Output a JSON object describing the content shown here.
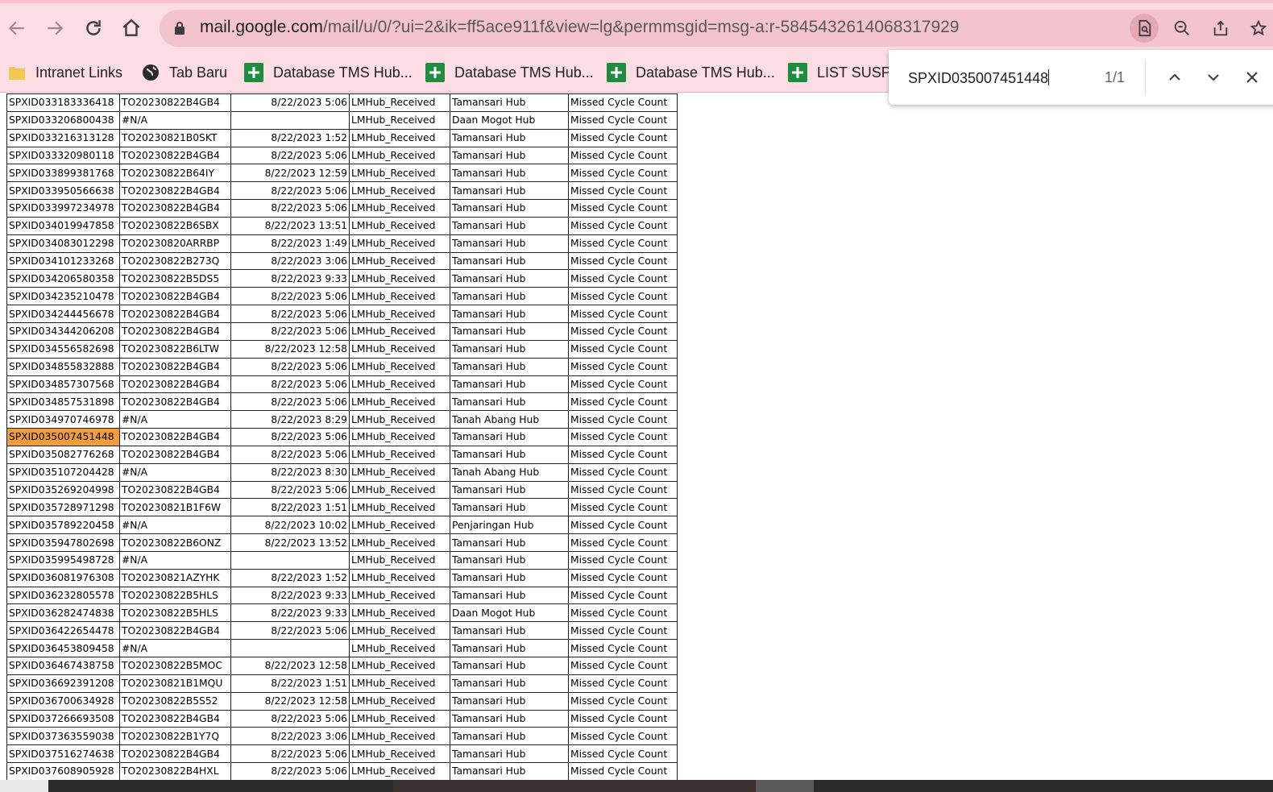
{
  "browser": {
    "url_host": "mail.google.com",
    "url_path": "/mail/u/0/?ui=2&ik=ff5ace911f&view=lg&permmsgid=msg-a:r-5845432614068317929",
    "bookmarks": [
      {
        "label": "Intranet Links",
        "icon": "folder-icon"
      },
      {
        "label": "Tab Baru",
        "icon": "globe-icon"
      },
      {
        "label": "Database TMS Hub...",
        "icon": "sheets-icon"
      },
      {
        "label": "Database TMS Hub...",
        "icon": "sheets-icon"
      },
      {
        "label": "Database TMS Hub...",
        "icon": "sheets-icon"
      },
      {
        "label": "LIST SUSPE",
        "icon": "sheets-icon"
      }
    ]
  },
  "find": {
    "query": "SPXID035007451448",
    "count": "1/1"
  },
  "colors": {
    "toolbar": "#fcdde3",
    "highlight": "#f29d3c"
  },
  "sheet": {
    "highlight_row": 19,
    "rows": [
      [
        "SPXID033183336418",
        "TO20230822B4GB4",
        "8/22/2023 5:06",
        "LMHub_Received",
        "Tamansari Hub",
        "Missed Cycle Count"
      ],
      [
        "SPXID033206800438",
        "#N/A",
        "",
        "LMHub_Received",
        "Daan Mogot Hub",
        "Missed Cycle Count"
      ],
      [
        "SPXID033216313128",
        "TO20230821B0SKT",
        "8/22/2023 1:52",
        "LMHub_Received",
        "Tamansari Hub",
        "Missed Cycle Count"
      ],
      [
        "SPXID033320980118",
        "TO20230822B4GB4",
        "8/22/2023 5:06",
        "LMHub_Received",
        "Tamansari Hub",
        "Missed Cycle Count"
      ],
      [
        "SPXID033899381768",
        "TO20230822B64IY",
        "8/22/2023 12:59",
        "LMHub_Received",
        "Tamansari Hub",
        "Missed Cycle Count"
      ],
      [
        "SPXID033950566638",
        "TO20230822B4GB4",
        "8/22/2023 5:06",
        "LMHub_Received",
        "Tamansari Hub",
        "Missed Cycle Count"
      ],
      [
        "SPXID033997234978",
        "TO20230822B4GB4",
        "8/22/2023 5:06",
        "LMHub_Received",
        "Tamansari Hub",
        "Missed Cycle Count"
      ],
      [
        "SPXID034019947858",
        "TO20230822B6SBX",
        "8/22/2023 13:51",
        "LMHub_Received",
        "Tamansari Hub",
        "Missed Cycle Count"
      ],
      [
        "SPXID034083012298",
        "TO20230820ARRBP",
        "8/22/2023 1:49",
        "LMHub_Received",
        "Tamansari Hub",
        "Missed Cycle Count"
      ],
      [
        "SPXID034101233268",
        "TO20230822B273Q",
        "8/22/2023 3:06",
        "LMHub_Received",
        "Tamansari Hub",
        "Missed Cycle Count"
      ],
      [
        "SPXID034206580358",
        "TO20230822B5DS5",
        "8/22/2023 9:33",
        "LMHub_Received",
        "Tamansari Hub",
        "Missed Cycle Count"
      ],
      [
        "SPXID034235210478",
        "TO20230822B4GB4",
        "8/22/2023 5:06",
        "LMHub_Received",
        "Tamansari Hub",
        "Missed Cycle Count"
      ],
      [
        "SPXID034244456678",
        "TO20230822B4GB4",
        "8/22/2023 5:06",
        "LMHub_Received",
        "Tamansari Hub",
        "Missed Cycle Count"
      ],
      [
        "SPXID034344206208",
        "TO20230822B4GB4",
        "8/22/2023 5:06",
        "LMHub_Received",
        "Tamansari Hub",
        "Missed Cycle Count"
      ],
      [
        "SPXID034556582698",
        "TO20230822B6LTW",
        "8/22/2023 12:58",
        "LMHub_Received",
        "Tamansari Hub",
        "Missed Cycle Count"
      ],
      [
        "SPXID034855832888",
        "TO20230822B4GB4",
        "8/22/2023 5:06",
        "LMHub_Received",
        "Tamansari Hub",
        "Missed Cycle Count"
      ],
      [
        "SPXID034857307568",
        "TO20230822B4GB4",
        "8/22/2023 5:06",
        "LMHub_Received",
        "Tamansari Hub",
        "Missed Cycle Count"
      ],
      [
        "SPXID034857531898",
        "TO20230822B4GB4",
        "8/22/2023 5:06",
        "LMHub_Received",
        "Tamansari Hub",
        "Missed Cycle Count"
      ],
      [
        "SPXID034970746978",
        "#N/A",
        "8/22/2023 8:29",
        "LMHub_Received",
        "Tanah Abang Hub",
        "Missed Cycle Count"
      ],
      [
        "SPXID035007451448",
        "TO20230822B4GB4",
        "8/22/2023 5:06",
        "LMHub_Received",
        "Tamansari Hub",
        "Missed Cycle Count"
      ],
      [
        "SPXID035082776268",
        "TO20230822B4GB4",
        "8/22/2023 5:06",
        "LMHub_Received",
        "Tamansari Hub",
        "Missed Cycle Count"
      ],
      [
        "SPXID035107204428",
        "#N/A",
        "8/22/2023 8:30",
        "LMHub_Received",
        "Tanah Abang Hub",
        "Missed Cycle Count"
      ],
      [
        "SPXID035269204998",
        "TO20230822B4GB4",
        "8/22/2023 5:06",
        "LMHub_Received",
        "Tamansari Hub",
        "Missed Cycle Count"
      ],
      [
        "SPXID035728971298",
        "TO20230821B1F6W",
        "8/22/2023 1:51",
        "LMHub_Received",
        "Tamansari Hub",
        "Missed Cycle Count"
      ],
      [
        "SPXID035789220458",
        "#N/A",
        "8/22/2023 10:02",
        "LMHub_Received",
        "Penjaringan Hub",
        "Missed Cycle Count"
      ],
      [
        "SPXID035947802698",
        "TO20230822B6ONZ",
        "8/22/2023 13:52",
        "LMHub_Received",
        "Tamansari Hub",
        "Missed Cycle Count"
      ],
      [
        "SPXID035995498728",
        "#N/A",
        "",
        "LMHub_Received",
        "Tamansari Hub",
        "Missed Cycle Count"
      ],
      [
        "SPXID036081976308",
        "TO20230821AZYHK",
        "8/22/2023 1:52",
        "LMHub_Received",
        "Tamansari Hub",
        "Missed Cycle Count"
      ],
      [
        "SPXID036232805578",
        "TO20230822B5HLS",
        "8/22/2023 9:33",
        "LMHub_Received",
        "Tamansari Hub",
        "Missed Cycle Count"
      ],
      [
        "SPXID036282474838",
        "TO20230822B5HLS",
        "8/22/2023 9:33",
        "LMHub_Received",
        "Daan Mogot Hub",
        "Missed Cycle Count"
      ],
      [
        "SPXID036422654478",
        "TO20230822B4GB4",
        "8/22/2023 5:06",
        "LMHub_Received",
        "Tamansari Hub",
        "Missed Cycle Count"
      ],
      [
        "SPXID036453809458",
        "#N/A",
        "",
        "LMHub_Received",
        "Tamansari Hub",
        "Missed Cycle Count"
      ],
      [
        "SPXID036467438758",
        "TO20230822B5MOC",
        "8/22/2023 12:58",
        "LMHub_Received",
        "Tamansari Hub",
        "Missed Cycle Count"
      ],
      [
        "SPXID036692391208",
        "TO20230821B1MQU",
        "8/22/2023 1:51",
        "LMHub_Received",
        "Tamansari Hub",
        "Missed Cycle Count"
      ],
      [
        "SPXID036700634928",
        "TO20230822B5S52",
        "8/22/2023 12:58",
        "LMHub_Received",
        "Tamansari Hub",
        "Missed Cycle Count"
      ],
      [
        "SPXID037266693508",
        "TO20230822B4GB4",
        "8/22/2023 5:06",
        "LMHub_Received",
        "Tamansari Hub",
        "Missed Cycle Count"
      ],
      [
        "SPXID037363559038",
        "TO20230822B1Y7Q",
        "8/22/2023 3:06",
        "LMHub_Received",
        "Tamansari Hub",
        "Missed Cycle Count"
      ],
      [
        "SPXID037516274638",
        "TO20230822B4GB4",
        "8/22/2023 5:06",
        "LMHub_Received",
        "Tamansari Hub",
        "Missed Cycle Count"
      ],
      [
        "SPXID037608905928",
        "TO20230822B4HXL",
        "8/22/2023 5:06",
        "LMHub_Received",
        "Tamansari Hub",
        "Missed Cycle Count"
      ]
    ]
  }
}
